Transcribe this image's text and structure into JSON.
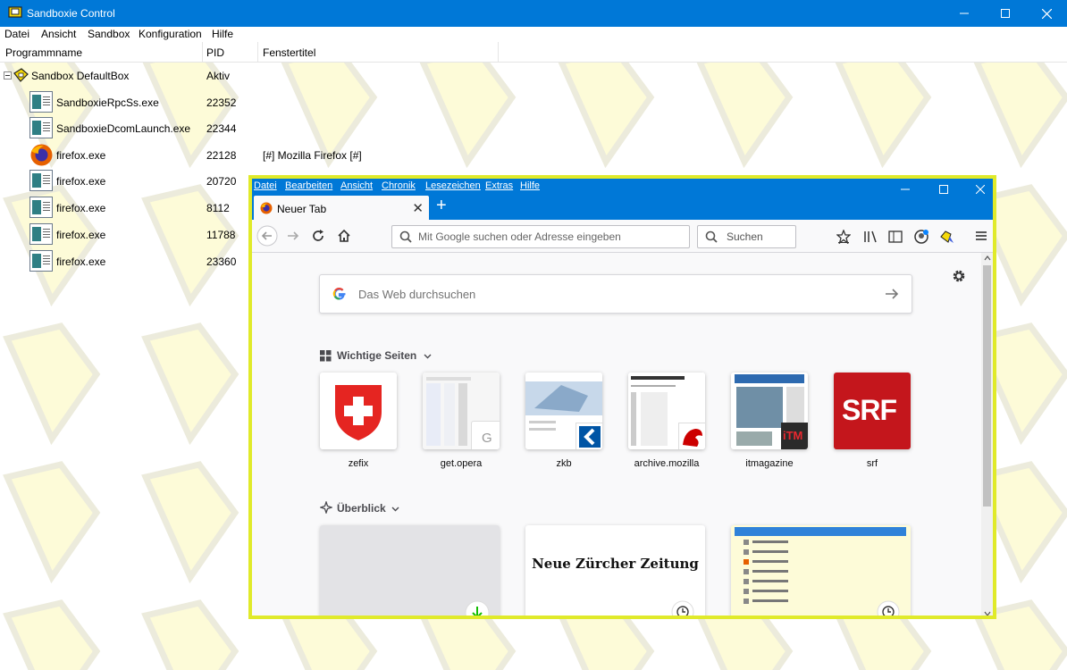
{
  "window": {
    "title": "Sandboxie Control"
  },
  "menu": [
    "Datei",
    "Ansicht",
    "Sandbox",
    "Konfiguration",
    "Hilfe"
  ],
  "columns": {
    "name": "Programmname",
    "pid": "PID",
    "title": "Fenstertitel"
  },
  "sandbox": {
    "label": "Sandbox DefaultBox",
    "status": "Aktiv"
  },
  "processes": [
    {
      "name": "SandboxieRpcSs.exe",
      "pid": "22352",
      "title": "",
      "icon": "exe-icon"
    },
    {
      "name": "SandboxieDcomLaunch.exe",
      "pid": "22344",
      "title": "",
      "icon": "exe-icon"
    },
    {
      "name": "firefox.exe",
      "pid": "22128",
      "title": "[#] Mozilla Firefox [#]",
      "icon": "firefox-icon"
    },
    {
      "name": "firefox.exe",
      "pid": "20720",
      "title": "",
      "icon": "exe-icon"
    },
    {
      "name": "firefox.exe",
      "pid": "8112",
      "title": "",
      "icon": "exe-icon"
    },
    {
      "name": "firefox.exe",
      "pid": "11788",
      "title": "",
      "icon": "exe-icon"
    },
    {
      "name": "firefox.exe",
      "pid": "23360",
      "title": "",
      "icon": "exe-icon"
    }
  ],
  "firefox": {
    "menu": [
      "Datei",
      "Bearbeiten",
      "Ansicht",
      "Chronik",
      "Lesezeichen",
      "Extras",
      "Hilfe"
    ],
    "tab_label": "Neuer Tab",
    "url_placeholder": "Mit Google suchen oder Adresse eingeben",
    "search_placeholder": "Suchen",
    "web_search_placeholder": "Das Web durchsuchen",
    "top_sites_heading": "Wichtige Seiten",
    "highlights_heading": "Überblick",
    "top_sites": [
      "zefix",
      "get.opera",
      "zkb",
      "archive.mozilla",
      "itmagazine",
      "srf"
    ],
    "srf_logo": "SRF",
    "itm_logo": "iTM",
    "get_opera_letter": "G",
    "nzz_title": "Neue Zürcher Zeitung"
  },
  "colors": {
    "titlebar": "#0078d7",
    "firefox_border": "#e0ea2a",
    "pattern_fill": "#fdfbd8"
  }
}
